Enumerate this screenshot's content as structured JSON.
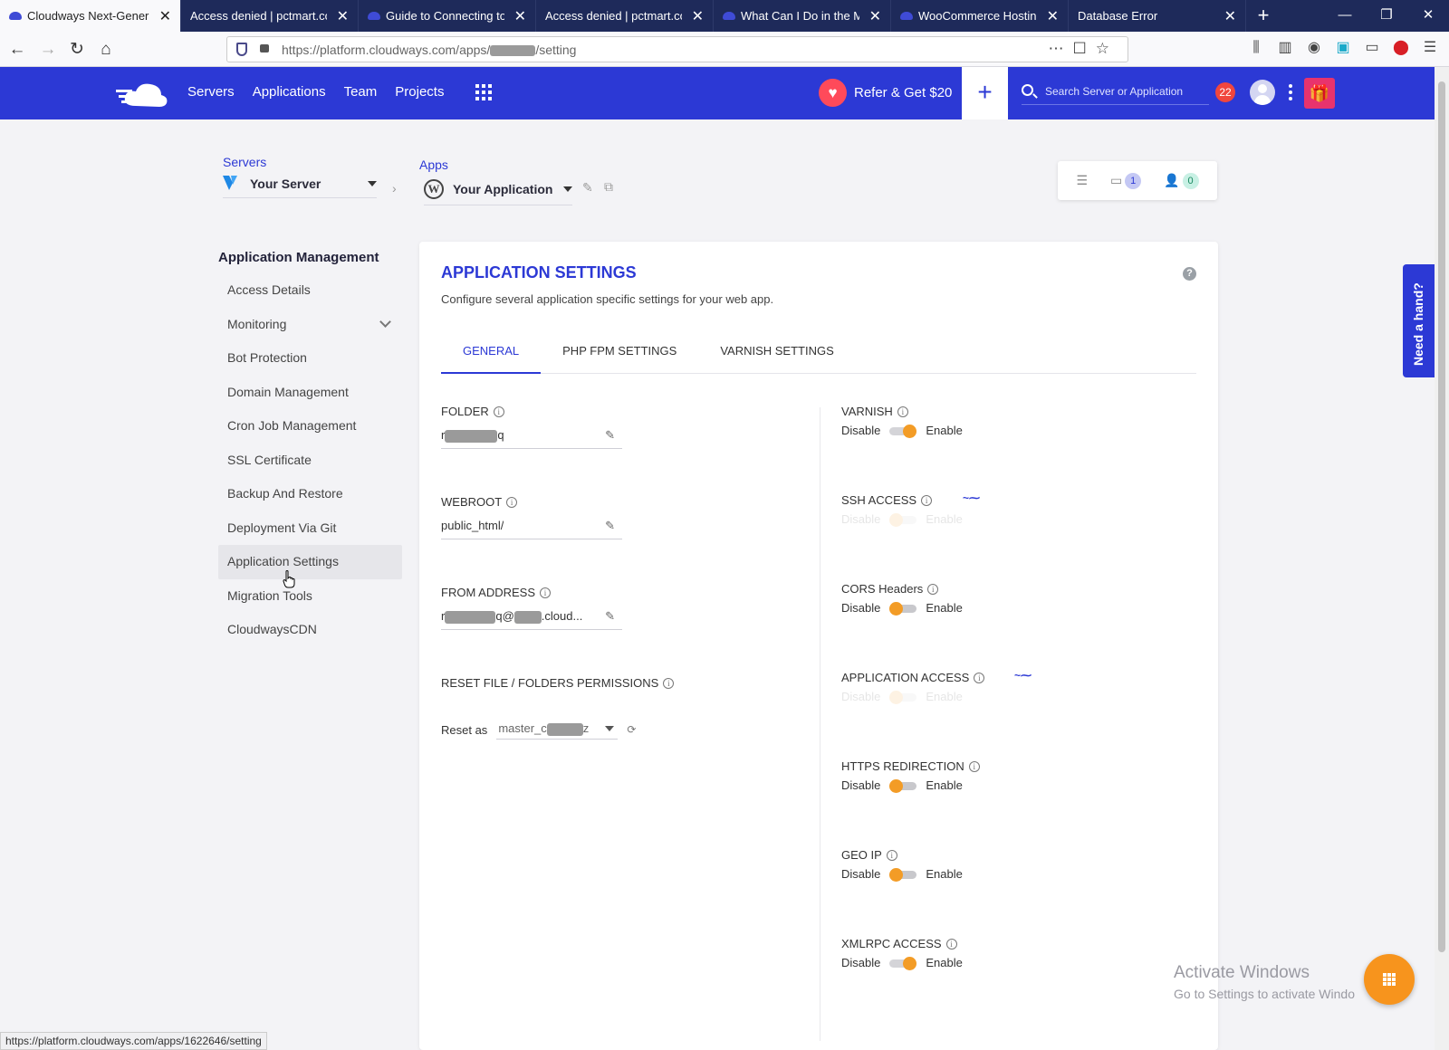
{
  "browser": {
    "tabs": [
      {
        "title": "Cloudways Next-Generati",
        "active": true,
        "favicon": "cloudways-icon"
      },
      {
        "title": "Access denied | pctmart.com",
        "active": false,
        "favicon": null
      },
      {
        "title": "Guide to Connecting to Yc",
        "active": false,
        "favicon": "cloudways-icon"
      },
      {
        "title": "Access denied | pctmart.com",
        "active": false,
        "favicon": null
      },
      {
        "title": "What Can I Do in the Man",
        "active": false,
        "favicon": "cloudways-icon"
      },
      {
        "title": "WooCommerce Hosting",
        "active": false,
        "favicon": "cloudways-icon"
      },
      {
        "title": "Database Error",
        "active": false,
        "favicon": null
      }
    ],
    "url_prefix": "https://platform.cloudways.com/apps/",
    "url_suffix": "/setting",
    "status_url": "https://platform.cloudways.com/apps/1622646/setting"
  },
  "header": {
    "nav": [
      "Servers",
      "Applications",
      "Team",
      "Projects"
    ],
    "refer_label": "Refer & Get $20",
    "search_placeholder": "Search Server or Application",
    "notification_count": "22",
    "accent_color": "#2c39d5"
  },
  "breadcrumb": {
    "servers_label": "Servers",
    "server_name": "Your Server",
    "apps_label": "Apps",
    "app_name": "Your Application",
    "folder_count": "1",
    "team_count": "0"
  },
  "sidebar": {
    "title": "Application Management",
    "items": [
      {
        "label": "Access Details",
        "selected": false
      },
      {
        "label": "Monitoring",
        "selected": false,
        "expandable": true
      },
      {
        "label": "Bot Protection",
        "selected": false
      },
      {
        "label": "Domain Management",
        "selected": false
      },
      {
        "label": "Cron Job Management",
        "selected": false
      },
      {
        "label": "SSL Certificate",
        "selected": false
      },
      {
        "label": "Backup And Restore",
        "selected": false
      },
      {
        "label": "Deployment Via Git",
        "selected": false
      },
      {
        "label": "Application Settings",
        "selected": true
      },
      {
        "label": "Migration Tools",
        "selected": false
      },
      {
        "label": "CloudwaysCDN",
        "selected": false
      }
    ]
  },
  "main": {
    "title": "APPLICATION SETTINGS",
    "subtitle": "Configure several application specific settings for your web app.",
    "tabs": [
      {
        "label": "GENERAL",
        "active": true
      },
      {
        "label": "PHP FPM SETTINGS",
        "active": false
      },
      {
        "label": "VARNISH SETTINGS",
        "active": false
      }
    ],
    "fields": {
      "folder_label": "FOLDER",
      "folder_value_start": "r",
      "folder_value_end": "q",
      "webroot_label": "WEBROOT",
      "webroot_value": "public_html/",
      "from_label": "FROM ADDRESS",
      "from_value_a": "r",
      "from_value_b": "q@",
      "from_value_c": ".cloud...",
      "reset_label": "RESET FILE / FOLDERS PERMISSIONS",
      "reset_as": "Reset as",
      "reset_value_start": "master_c",
      "reset_value_end": "z"
    },
    "toggles": [
      {
        "label": "VARNISH",
        "on": true,
        "loading": false
      },
      {
        "label": "SSH ACCESS",
        "on": false,
        "loading": true
      },
      {
        "label": "CORS Headers",
        "on": false,
        "loading": false
      },
      {
        "label": "APPLICATION ACCESS",
        "on": false,
        "loading": true
      },
      {
        "label": "HTTPS REDIRECTION",
        "on": false,
        "loading": false
      },
      {
        "label": "GEO IP",
        "on": false,
        "loading": false
      },
      {
        "label": "XMLRPC ACCESS",
        "on": true,
        "loading": false
      }
    ],
    "disable_label": "Disable",
    "enable_label": "Enable",
    "toggle_color": "#f39c26"
  },
  "widgets": {
    "need_hand": "Need a hand?",
    "activate_title": "Activate Windows",
    "activate_sub": "Go to Settings to activate Windo"
  }
}
